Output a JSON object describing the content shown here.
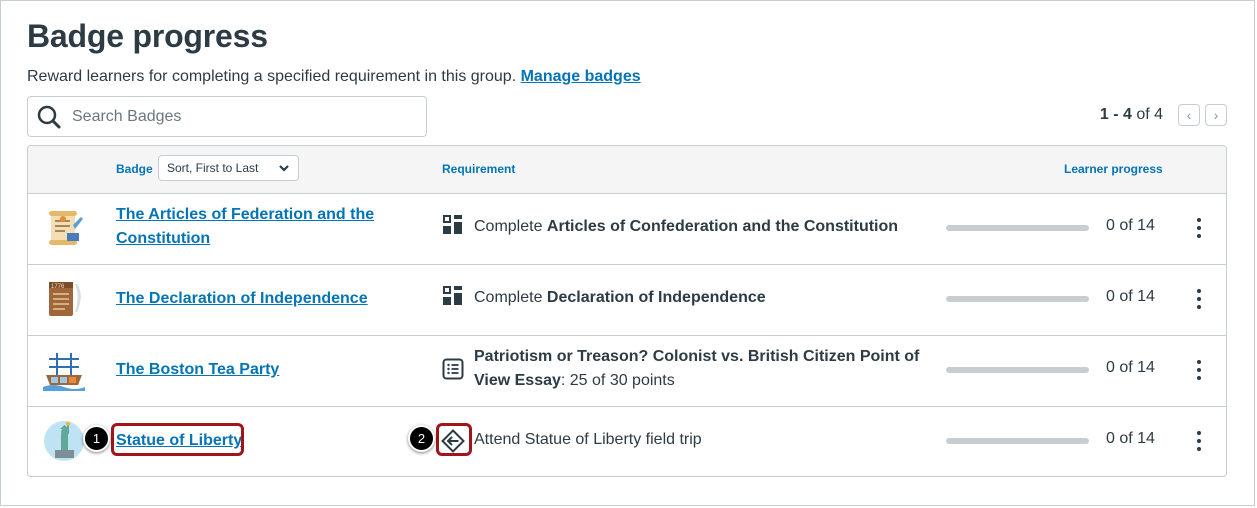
{
  "page": {
    "title": "Badge progress",
    "subtitle": "Reward learners for completing a specified requirement in this group.",
    "manage_link": "Manage badges"
  },
  "search": {
    "placeholder": "Search Badges",
    "value": ""
  },
  "pager": {
    "range": "1 - 4",
    "of_label": "of 4",
    "prev": "‹",
    "next": "›"
  },
  "table": {
    "headers": {
      "badge": "Badge",
      "sort": "Sort, First to Last",
      "requirement": "Requirement",
      "progress": "Learner progress"
    },
    "rows": [
      {
        "badge": "The Articles of Federation and the Constitution",
        "badge_line1": "The Articles of Federation and the",
        "badge_line2": "Constitution",
        "req_prefix": "Complete ",
        "req_bold": "Articles of Confederation and the Constitution",
        "req_suffix": "",
        "req_icon": "module-icon",
        "progress_fraction": 0,
        "progress": "0 of 14"
      },
      {
        "badge": "The Declaration of Independence",
        "req_prefix": "Complete ",
        "req_bold": "Declaration of Independence",
        "req_suffix": "",
        "req_icon": "module-icon",
        "progress_fraction": 0,
        "progress": "0 of 14"
      },
      {
        "badge": "The Boston Tea Party",
        "req_prefix": "",
        "req_bold": "Patriotism or Treason? Colonist vs. British Citizen Point of View Essay",
        "req_bold_line1": "Patriotism or Treason? Colonist vs. British Citizen Point of",
        "req_bold_line2": "View Essay",
        "req_suffix": ": 25 of 30 points",
        "req_icon": "assignment-icon",
        "progress_fraction": 0,
        "progress": "0 of 14"
      },
      {
        "badge": "Statue of Liberty",
        "req_prefix": "",
        "req_bold": "",
        "req_suffix": "Attend Statue of Liberty field trip",
        "req_icon": "external-activity-icon",
        "progress_fraction": 0,
        "progress": "0 of 14"
      }
    ]
  },
  "callouts": [
    "1",
    "2"
  ],
  "colors": {
    "link": "#0374b5",
    "text": "#2d3b45",
    "highlight": "#a1141a",
    "border": "#c7cdd1"
  }
}
